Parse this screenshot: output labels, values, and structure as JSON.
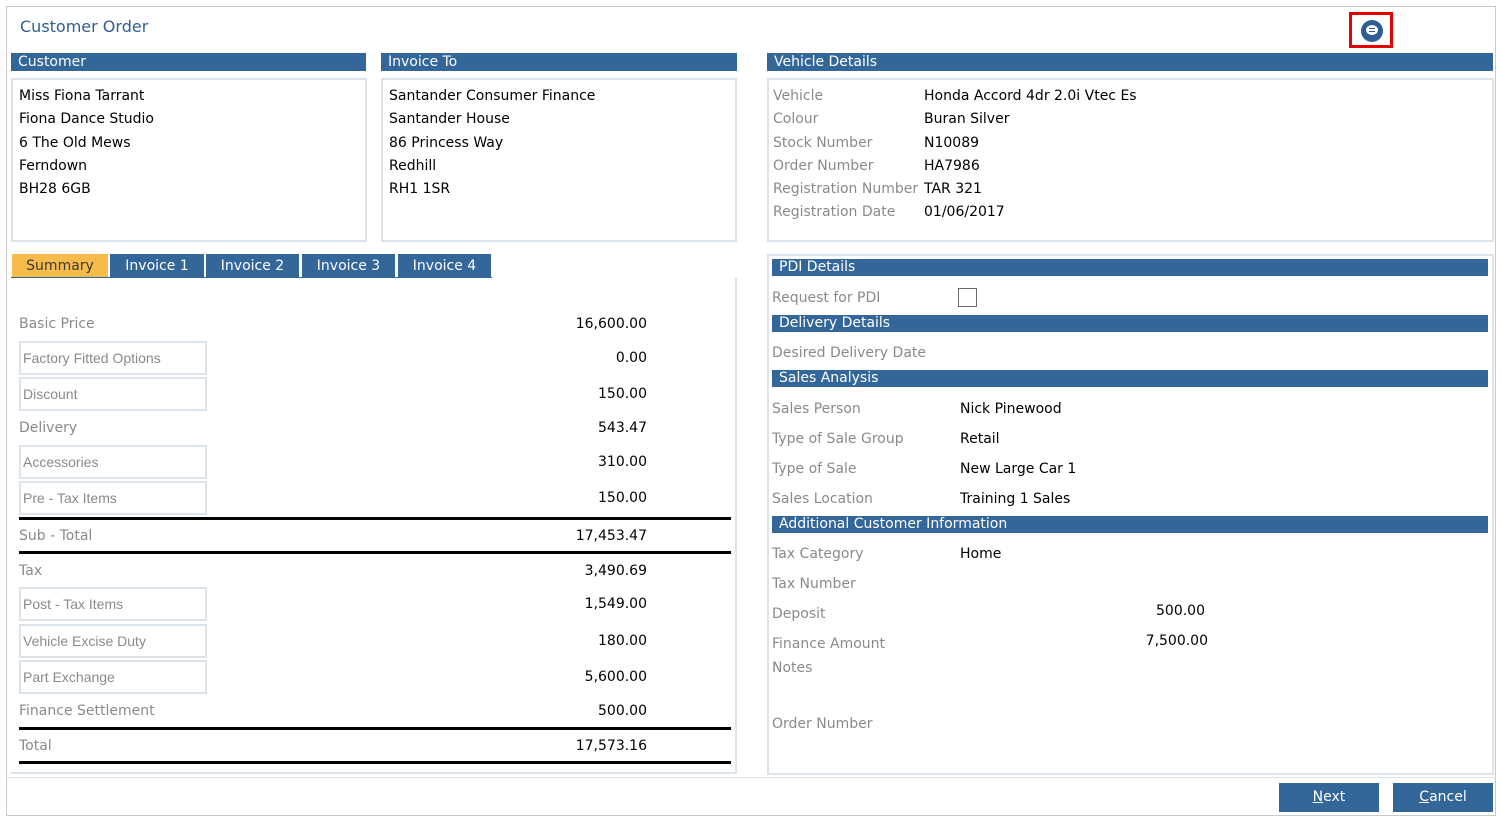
{
  "window": {
    "title": "Customer Order",
    "chat_icon": "chat-bubble-icon"
  },
  "customer": {
    "header": "Customer",
    "lines": [
      "Miss Fiona Tarrant",
      "Fiona Dance Studio",
      "6 The Old Mews",
      "Ferndown",
      "BH28 6GB"
    ]
  },
  "invoice_to": {
    "header": "Invoice To",
    "lines": [
      "Santander Consumer Finance",
      "Santander House",
      "86 Princess Way",
      "Redhill",
      "RH1 1SR"
    ]
  },
  "vehicle": {
    "header": "Vehicle Details",
    "rows": [
      {
        "label": "Vehicle",
        "value": "Honda Accord 4dr 2.0i Vtec Es"
      },
      {
        "label": "Colour",
        "value": "Buran Silver"
      },
      {
        "label": "Stock Number",
        "value": "N10089"
      },
      {
        "label": "Order Number",
        "value": "HA7986"
      },
      {
        "label": "Registration Number",
        "value": "TAR 321"
      },
      {
        "label": "Registration Date",
        "value": "01/06/2017"
      }
    ]
  },
  "tabs": [
    {
      "label": "Summary",
      "active": true
    },
    {
      "label": "Invoice 1",
      "active": false
    },
    {
      "label": "Invoice 2",
      "active": false
    },
    {
      "label": "Invoice 3",
      "active": false
    },
    {
      "label": "Invoice 4",
      "active": false
    }
  ],
  "summary": {
    "basic_price": {
      "label": "Basic Price",
      "value": "16,600.00"
    },
    "factory_fitted_options": {
      "label": "Factory Fitted Options",
      "value": "0.00"
    },
    "discount": {
      "label": "Discount",
      "value": "150.00"
    },
    "delivery": {
      "label": "Delivery",
      "value": "543.47"
    },
    "accessories": {
      "label": "Accessories",
      "value": "310.00"
    },
    "pre_tax_items": {
      "label": "Pre - Tax Items",
      "value": "150.00"
    },
    "sub_total": {
      "label": "Sub - Total",
      "value": "17,453.47"
    },
    "tax": {
      "label": "Tax",
      "value": "3,490.69"
    },
    "post_tax_items": {
      "label": "Post - Tax Items",
      "value": "1,549.00"
    },
    "vehicle_excise_duty": {
      "label": "Vehicle Excise Duty",
      "value": "180.00"
    },
    "part_exchange": {
      "label": "Part Exchange",
      "value": "5,600.00"
    },
    "finance_settlement": {
      "label": "Finance Settlement",
      "value": "500.00"
    },
    "total": {
      "label": "Total",
      "value": "17,573.16"
    }
  },
  "pdi": {
    "header": "PDI Details",
    "request_label": "Request for PDI",
    "request_checked": false
  },
  "delivery_details": {
    "header": "Delivery Details",
    "desired_date_label": "Desired Delivery Date",
    "desired_date_value": ""
  },
  "sales_analysis": {
    "header": "Sales Analysis",
    "rows": [
      {
        "label": "Sales Person",
        "value": "Nick Pinewood"
      },
      {
        "label": "Type of Sale Group",
        "value": "Retail"
      },
      {
        "label": "Type of Sale",
        "value": "New Large Car 1"
      },
      {
        "label": "Sales Location",
        "value": "Training 1 Sales"
      }
    ]
  },
  "additional": {
    "header": "Additional Customer Information",
    "tax_category_label": "Tax Category",
    "tax_category_value": "Home",
    "tax_number_label": "Tax Number",
    "deposit_label": "Deposit",
    "deposit_value": "500.00",
    "finance_amount_label": "Finance Amount",
    "finance_amount_value": "7,500.00",
    "notes_label": "Notes",
    "order_number_label": "Order Number"
  },
  "buttons": {
    "next_access_key": "N",
    "next_rest": "ext",
    "cancel_access_key": "C",
    "cancel_rest": "ancel"
  }
}
